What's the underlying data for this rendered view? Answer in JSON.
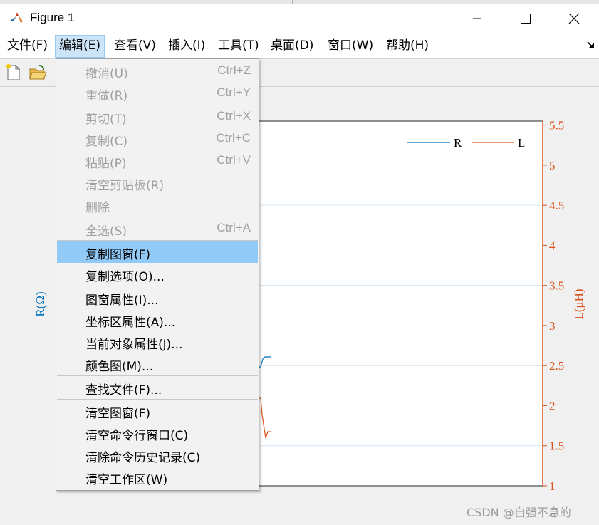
{
  "window": {
    "title": "Figure 1"
  },
  "menubar": {
    "items": [
      {
        "label": "文件(F)",
        "active": false
      },
      {
        "label": "编辑(E)",
        "active": true
      },
      {
        "label": "查看(V)",
        "active": false
      },
      {
        "label": "插入(I)",
        "active": false
      },
      {
        "label": "工具(T)",
        "active": false
      },
      {
        "label": "桌面(D)",
        "active": false
      },
      {
        "label": "窗口(W)",
        "active": false
      },
      {
        "label": "帮助(H)",
        "active": false
      }
    ]
  },
  "toolbar": {
    "icons": [
      "new-figure-icon",
      "open-file-icon"
    ]
  },
  "edit_menu": {
    "items": [
      {
        "label": "撤消(U)",
        "shortcut": "Ctrl+Z",
        "enabled": false,
        "highlighted": false
      },
      {
        "label": "重做(R)",
        "shortcut": "Ctrl+Y",
        "enabled": false,
        "highlighted": false
      },
      {
        "label": "剪切(T)",
        "shortcut": "Ctrl+X",
        "enabled": false,
        "highlighted": false
      },
      {
        "label": "复制(C)",
        "shortcut": "Ctrl+C",
        "enabled": false,
        "highlighted": false
      },
      {
        "label": "粘贴(P)",
        "shortcut": "Ctrl+V",
        "enabled": false,
        "highlighted": false
      },
      {
        "label": "清空剪贴板(R)",
        "shortcut": "",
        "enabled": false,
        "highlighted": false
      },
      {
        "label": "删除",
        "shortcut": "",
        "enabled": false,
        "highlighted": false
      },
      {
        "label": "全选(S)",
        "shortcut": "Ctrl+A",
        "enabled": false,
        "highlighted": false
      },
      {
        "label": "复制图窗(F)",
        "shortcut": "",
        "enabled": true,
        "highlighted": true
      },
      {
        "label": "复制选项(O)...",
        "shortcut": "",
        "enabled": true,
        "highlighted": false
      },
      {
        "label": "图窗属性(I)...",
        "shortcut": "",
        "enabled": true,
        "highlighted": false
      },
      {
        "label": "坐标区属性(A)...",
        "shortcut": "",
        "enabled": true,
        "highlighted": false
      },
      {
        "label": "当前对象属性(J)...",
        "shortcut": "",
        "enabled": true,
        "highlighted": false
      },
      {
        "label": "颜色图(M)...",
        "shortcut": "",
        "enabled": true,
        "highlighted": false
      },
      {
        "label": "查找文件(F)...",
        "shortcut": "",
        "enabled": true,
        "highlighted": false
      },
      {
        "label": "清空图窗(F)",
        "shortcut": "",
        "enabled": true,
        "highlighted": false
      },
      {
        "label": "清空命令行窗口(C)",
        "shortcut": "",
        "enabled": true,
        "highlighted": false
      },
      {
        "label": "清除命令历史记录(C)",
        "shortcut": "",
        "enabled": true,
        "highlighted": false
      },
      {
        "label": "清空工作区(W)",
        "shortcut": "",
        "enabled": true,
        "highlighted": false
      }
    ]
  },
  "chart_data": {
    "type": "line",
    "xlabel": "",
    "ylabel_left": "R(Ω)",
    "ylabel_right": "L(μH)",
    "right_axis": {
      "ticks": [
        "1",
        "1.5",
        "2",
        "2.5",
        "3",
        "3.5",
        "4",
        "4.5",
        "5",
        "5.5"
      ],
      "ylim": [
        1,
        5.55
      ]
    },
    "legend": {
      "placement": "top-right",
      "entries": [
        "R",
        "L"
      ]
    },
    "colors": {
      "R": "#0072bd",
      "L": "#d95319"
    },
    "grid": "horizontal",
    "series": [
      {
        "name": "R",
        "visible_fragment": "step up near x≈2.6 on right axis scale"
      },
      {
        "name": "L",
        "visible_fragment": "drop from ≈2.1 to ≈1.6 then up to ≈1.7"
      }
    ]
  },
  "watermark": "CSDN @自强不息的"
}
